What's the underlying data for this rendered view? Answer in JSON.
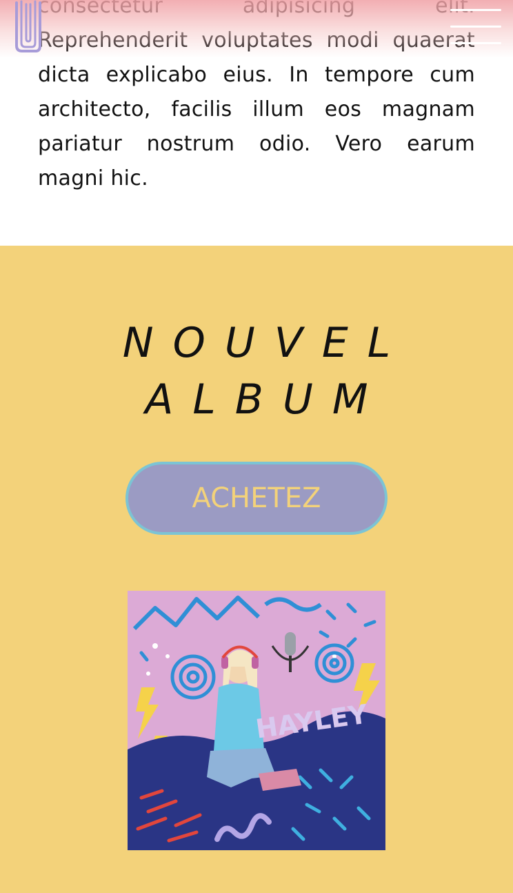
{
  "intro": {
    "paragraph": "consectetur adipisicing elit. Reprehenderit voluptates modi quaerat dicta explicabo eius. In tempore cum architecto, facilis illum eos magnam pariatur nostrum odio. Vero earum magni hic."
  },
  "header": {
    "logo_icon": "brand-logo-icon",
    "menu_icon": "hamburger-menu-icon"
  },
  "album": {
    "title_line1": "NOUVEL",
    "title_line2": "ALBUM",
    "buy_label": "ACHETEZ",
    "cover_artist": "HAYLEY"
  },
  "colors": {
    "header_gradient": "#f0a0a5",
    "section_bg": "#f3d27a",
    "button_bg": "#9b9bc3",
    "button_border": "#7cc4d4",
    "button_text": "#f3d27a",
    "cover_bg": "#dcaad6",
    "cover_blue": "#2a3585"
  }
}
